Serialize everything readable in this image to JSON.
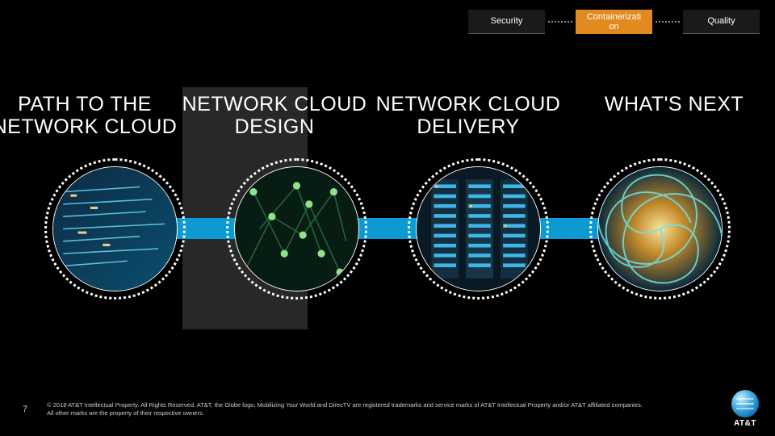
{
  "tabs": {
    "security": "Security",
    "containerization": "Containerizati\non",
    "quality": "Quality"
  },
  "headings": {
    "h1": "PATH TO THE NETWORK CLOUD",
    "h2": "NETWORK CLOUD DESIGN",
    "h3": "NETWORK CLOUD DELIVERY",
    "h4": "WHAT'S NEXT"
  },
  "footer": {
    "page": "7",
    "legal_line1": "© 2018 AT&T Intellectual Property.  All Rights Reserved.  AT&T, the Globe logo, Mobilizing Your World and DirecTV are registered trademarks and service marks of AT&T Intellectual Property and/or AT&T affiliated companies.",
    "legal_line2": "All other marks are the property of their respective owners.",
    "brand": "AT&T"
  },
  "colors": {
    "accent_blue": "#0d9ad0",
    "tab_active": "#e08a1f"
  }
}
